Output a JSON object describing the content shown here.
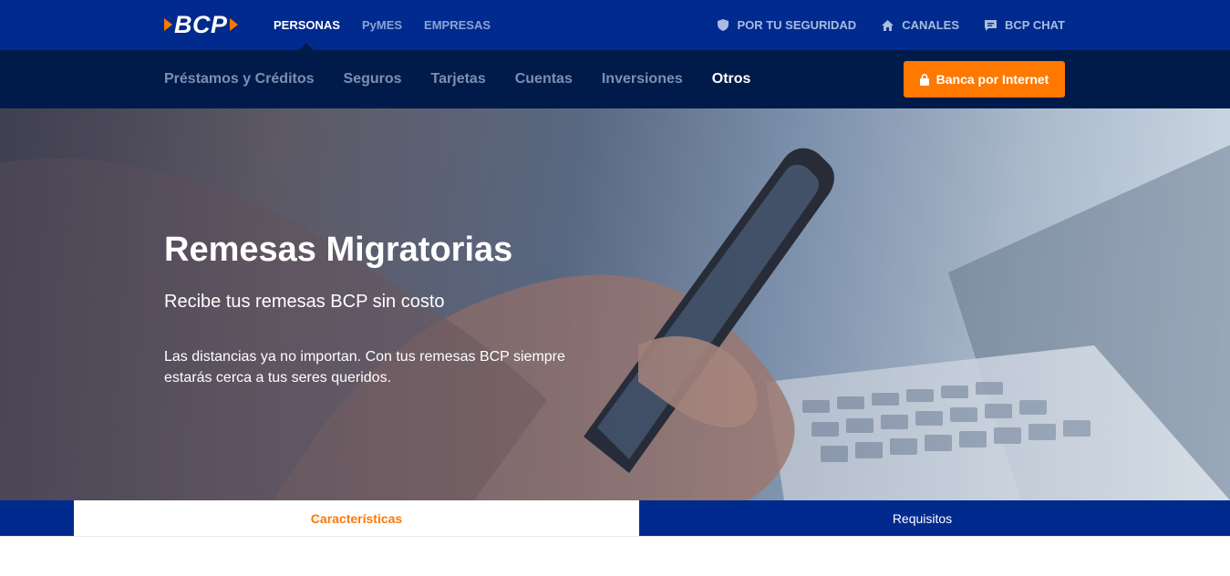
{
  "brand": {
    "logo_text": "BCP",
    "primary_color": "#002a8d",
    "nav_color": "#001b4a",
    "accent_color": "#ff7800"
  },
  "topbar": {
    "segments": [
      {
        "label": "PERSONAS",
        "active": true
      },
      {
        "label": "PyMES",
        "active": false
      },
      {
        "label": "EMPRESAS",
        "active": false
      }
    ],
    "utilities": [
      {
        "label": "POR TU SEGURIDAD",
        "icon": "shield-icon"
      },
      {
        "label": "CANALES",
        "icon": "home-icon"
      },
      {
        "label": "BCP CHAT",
        "icon": "chat-icon"
      }
    ]
  },
  "navbar": {
    "items": [
      {
        "label": "Préstamos y Créditos",
        "active": false
      },
      {
        "label": "Seguros",
        "active": false
      },
      {
        "label": "Tarjetas",
        "active": false
      },
      {
        "label": "Cuentas",
        "active": false
      },
      {
        "label": "Inversiones",
        "active": false
      },
      {
        "label": "Otros",
        "active": true
      }
    ],
    "cta_label": "Banca por Internet",
    "cta_icon": "lock-icon"
  },
  "hero": {
    "title": "Remesas Migratorias",
    "subtitle": "Recibe tus remesas BCP sin costo",
    "description": "Las distancias ya no importan. Con tus remesas BCP siempre estarás cerca a tus seres queridos."
  },
  "tabs": [
    {
      "label": "Características",
      "active": true
    },
    {
      "label": "Requisitos",
      "active": false
    }
  ]
}
